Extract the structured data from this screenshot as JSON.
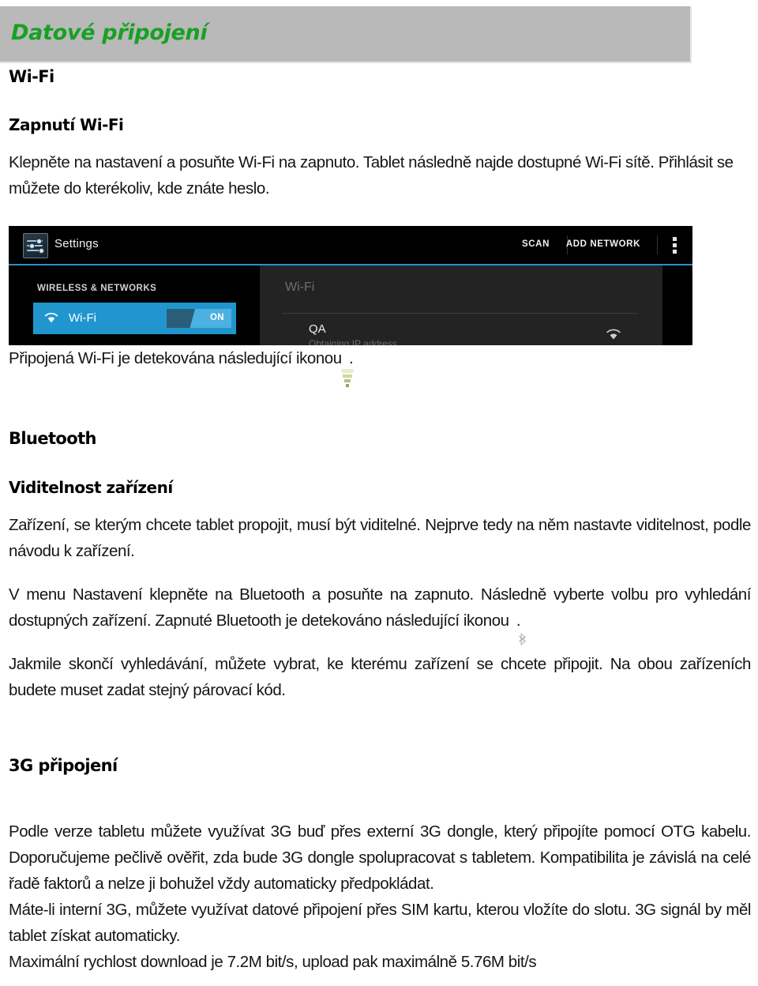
{
  "banner": {
    "title": "Datové připojení",
    "bg_color": "#b9b9b9",
    "title_color": "#17a024"
  },
  "sections": {
    "wifi_heading": "Wi-Fi",
    "wifi_sub_heading": "Zapnutí Wi-Fi",
    "wifi_paragraph": "Klepněte na nastavení a posuňte Wi-Fi na zapnuto. Tablet následně najde dostupné Wi-Fi sítě. Přihlásit se můžete do kterékoliv, kde znáte heslo.",
    "wifi_icon_line_before": "Připojená Wi-Fi je detekována následující ikonou",
    "wifi_icon_line_after": ".",
    "bluetooth_heading": "Bluetooth",
    "bluetooth_sub_heading": "Viditelnost zařízení",
    "bluetooth_paragraph_1": "Zařízení, se kterým chcete tablet propojit, musí být viditelné. Nejprve tedy na něm nastavte viditelnost, podle návodu k zařízení.",
    "bluetooth_paragraph_2_before": "V menu Nastavení klepněte na Bluetooth a posuňte na zapnuto. Následně vyberte volbu pro vyhledání dostupných zařízení. Zapnuté Bluetooth je detekováno následující ikonou",
    "bluetooth_paragraph_2_after": ".",
    "bluetooth_paragraph_3": "Jakmile skončí vyhledávání, můžete vybrat, ke kterému zařízení se chcete připojit. Na obou zařízeních budete muset zadat stejný párovací kód.",
    "threeg_heading": "3G připojení",
    "threeg_paragraph_1": "Podle verze tabletu můžete využívat 3G buď přes externí 3G dongle, který připojíte pomocí OTG kabelu. Doporučujeme pečlivě ověřit, zda bude 3G dongle spolupracovat s tabletem. Kompatibilita je závislá na celé řadě faktorů a nelze ji bohužel vždy automaticky předpokládat.",
    "threeg_paragraph_2": "Máte-li interní 3G, můžete využívat datové připojení přes SIM kartu, kterou vložíte do slotu. 3G signál by měl tablet získat automaticky.",
    "threeg_paragraph_3": "Maximální rychlost download je 7.2M bit/s, upload pak maximálně 5.76M bit/s"
  },
  "screenshot": {
    "app_title": "Settings",
    "action_scan": "SCAN",
    "action_add_network": "ADD NETWORK",
    "category_label": "WIRELESS & NETWORKS",
    "wifi_row_label": "Wi-Fi",
    "wifi_toggle_state": "ON",
    "detail_header": "Wi-Fi",
    "network_name": "QA",
    "network_status": "Obtaining IP address",
    "accent_color": "#2196ce",
    "underline_color": "#2e8fc4",
    "background_color": "#000000",
    "panel_color": "#232323"
  },
  "icons": {
    "wifi_signal": "wifi-signal-icon",
    "bluetooth": "bluetooth-icon",
    "settings_app": "settings-sliders-icon",
    "overflow_menu": "overflow-menu-icon"
  }
}
